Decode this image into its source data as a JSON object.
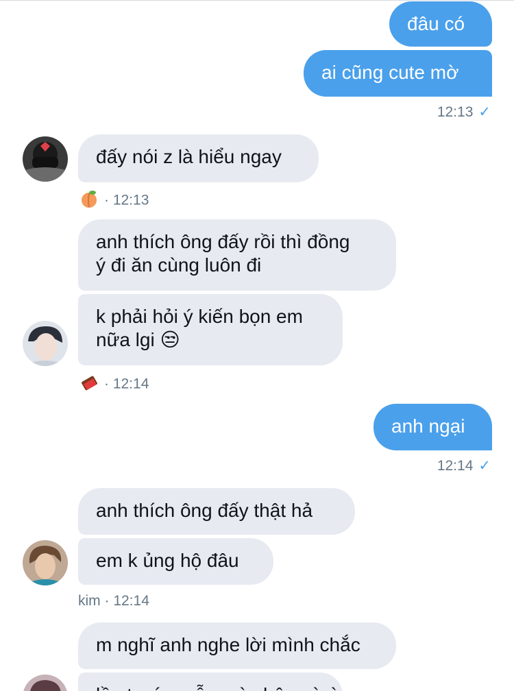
{
  "messages": {
    "m1": "đâu có",
    "m2": "ai cũng cute mờ",
    "m2_time": "12:13",
    "m3": "đấy nói z là hiểu ngay",
    "m3_time": "· 12:13",
    "m4_line1": "anh thích ông đấy rồi thì đồng",
    "m4_line2": "ý đi ăn cùng luôn đi",
    "m5_line1": "k phải hỏi ý kiến bọn em",
    "m5_line2": "nữa lgi",
    "m5_emoji": "😒",
    "m5_time": "· 12:14",
    "m6": "anh ngại",
    "m6_time": "12:14",
    "m7": "anh thích ông đấy thật hả",
    "m8": "em k ủng hộ đâu",
    "m8_meta": "kim · 12:14",
    "m9": "m nghĩ anh nghe lời mình chắc",
    "m10_partial": "lần trước mẫu mà chê ... ờ ờ"
  },
  "icons": {
    "check": "read-check-icon",
    "peach": "peach-emoji-icon",
    "chocolate": "chocolate-emoji-icon"
  },
  "colors": {
    "outgoing": "#4aa0eb",
    "incoming": "#e7eaf1",
    "meta": "#657786"
  }
}
